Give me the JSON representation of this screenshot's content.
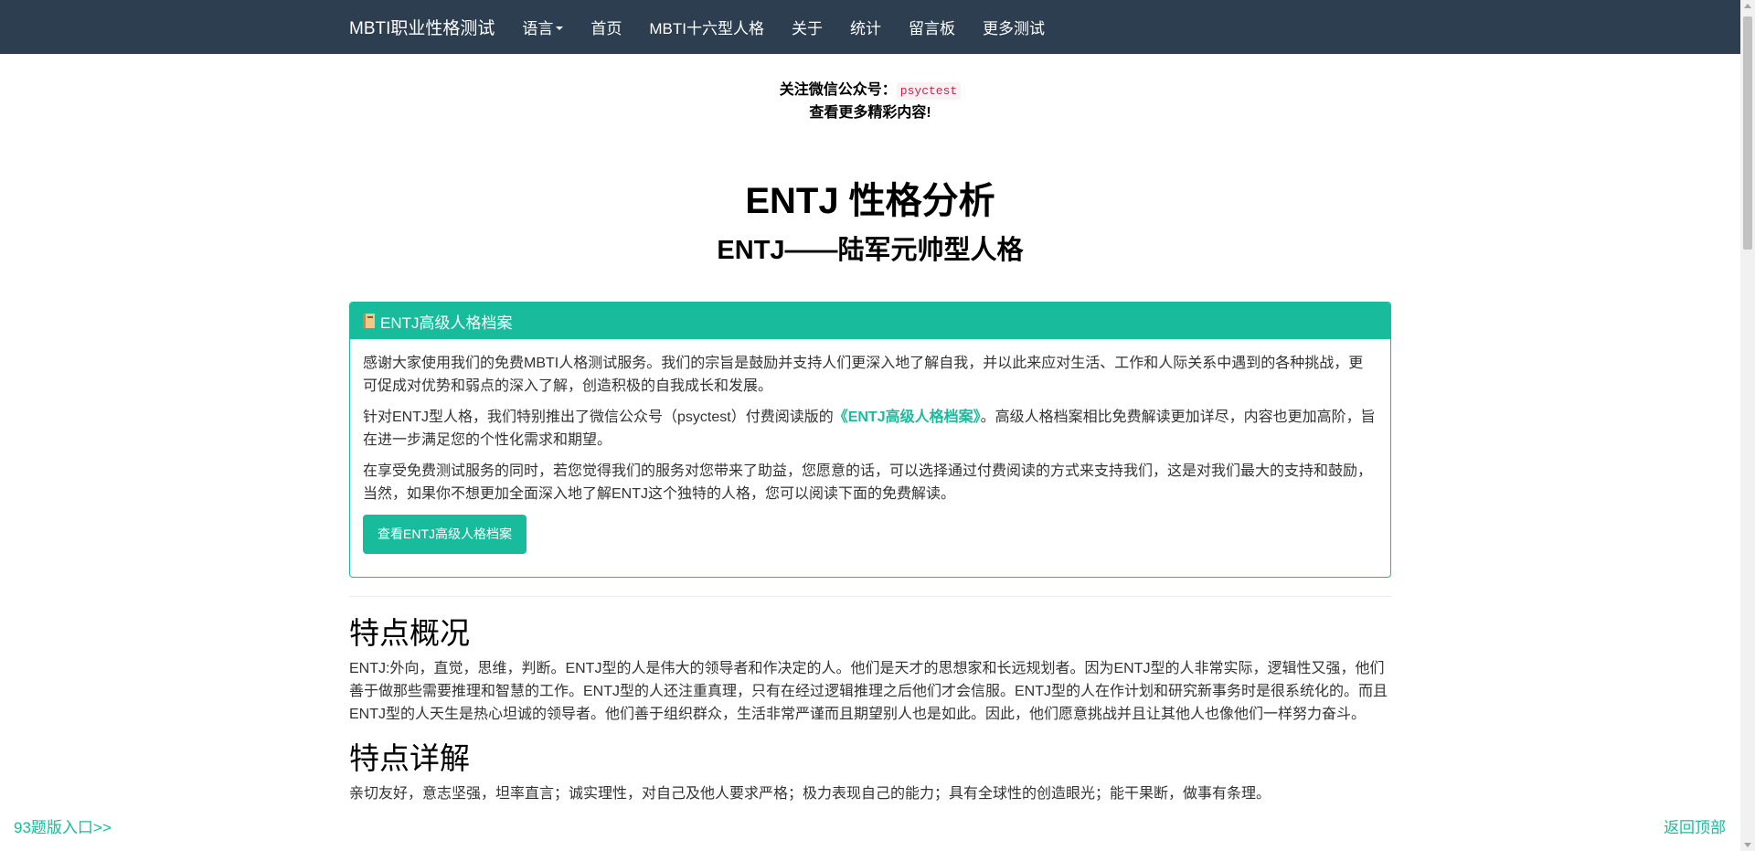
{
  "nav": {
    "brand": "MBTI职业性格测试",
    "links": [
      "语言",
      "首页",
      "MBTI十六型人格",
      "关于",
      "统计",
      "留言板",
      "更多测试"
    ]
  },
  "follow": {
    "line1_prefix": "关注微信公众号：",
    "code": "psyctest",
    "line2": "查看更多精彩内容!"
  },
  "title": "ENTJ 性格分析",
  "subtitle": "ENTJ——陆军元帅型人格",
  "panel": {
    "heading": "ENTJ高级人格档案",
    "heading_icon": "book-icon",
    "p1": "感谢大家使用我们的免费MBTI人格测试服务。我们的宗旨是鼓励并支持人们更深入地了解自我，并以此来应对生活、工作和人际关系中遇到的各种挑战，更可促成对优势和弱点的深入了解，创造积极的自我成长和发展。",
    "p2_before": "针对ENTJ型人格，我们特别推出了微信公众号（psyctest）付费阅读版的",
    "p2_link": "《ENTJ高级人格档案》",
    "p2_after": "。高级人格档案相比免费解读更加详尽，内容也更加高阶，旨在进一步满足您的个性化需求和期望。",
    "p3": "在享受免费测试服务的同时，若您觉得我们的服务对您带来了助益，您愿意的话，可以选择通过付费阅读的方式来支持我们，这是对我们最大的支持和鼓励，当然，如果你不想更加全面深入地了解ENTJ这个独特的人格，您可以阅读下面的免费解读。",
    "button": "查看ENTJ高级人格档案"
  },
  "overview": {
    "title": "特点概况",
    "text": "ENTJ:外向，直觉，思维，判断。ENTJ型的人是伟大的领导者和作决定的人。他们是天才的思想家和长远规划者。因为ENTJ型的人非常实际，逻辑性又强，他们善于做那些需要推理和智慧的工作。ENTJ型的人还注重真理，只有在经过逻辑推理之后他们才会信服。ENTJ型的人在作计划和研究新事务时是很系统化的。而且ENTJ型的人天生是热心坦诚的领导者。他们善于组织群众，生活非常严谨而且期望别人也是如此。因此，他们愿意挑战并且让其他人也像他们一样努力奋斗。"
  },
  "details": {
    "title": "特点详解",
    "text": "亲切友好，意志坚强，坦率直言；诚实理性，对自己及他人要求严格；极力表现自己的能力；具有全球性的创造眼光；能干果断，做事有条理。"
  },
  "floating": {
    "left": "93题版入口>>",
    "right": "返回顶部"
  },
  "colors": {
    "navbar": "#2c3e50",
    "accent": "#18bc9c",
    "code": "#c7254e"
  }
}
